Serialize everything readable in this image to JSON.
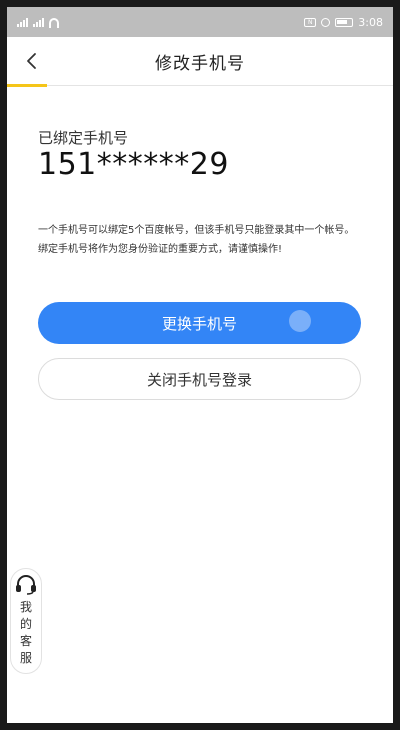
{
  "status_bar": {
    "time": "3:08",
    "nfc": "N"
  },
  "header": {
    "title": "修改手机号",
    "back_icon": "chevron-left-icon"
  },
  "account": {
    "bound_label": "已绑定手机号",
    "masked_phone": "151******29"
  },
  "notice": "一个手机号可以绑定5个百度帐号，但该手机号只能登录其中一个帐号。绑定手机号将作为您身份验证的重要方式，请谨慎操作!",
  "actions": {
    "change_phone": "更换手机号",
    "disable_phone_login": "关闭手机号登录"
  },
  "customer_service": {
    "label": "我的客服",
    "icon": "headset-icon"
  },
  "colors": {
    "primary": "#3385f6",
    "accent": "#f5c518",
    "status_bar": "#bdbdbd"
  }
}
